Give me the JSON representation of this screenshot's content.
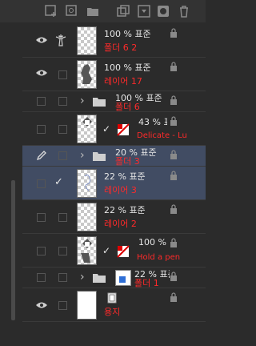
{
  "toolbar": {
    "icons": [
      "new-layer-icon",
      "new-vector-layer-icon",
      "new-folder-icon",
      "copy-layer-icon",
      "merge-layer-icon",
      "mask-icon",
      "delete-icon"
    ]
  },
  "layers": [
    {
      "top": "100 % 표준",
      "name": "폴더 6 2",
      "visible": true,
      "lighthouse": true
    },
    {
      "top": "100 % 표준",
      "name": "레이어 17",
      "visible": true
    },
    {
      "top": "100 % 표준",
      "name": "폴더 6",
      "folder": true
    },
    {
      "top": "43 % 표",
      "name": "Delicate - Lu",
      "effect": true
    },
    {
      "top": "20 % 표준",
      "name": "폴더 3",
      "folder": true,
      "selected": true,
      "pen": true
    },
    {
      "top": "22 % 표준",
      "name": "레이어 3",
      "selected": true,
      "check": true
    },
    {
      "top": "22 % 표준",
      "name": "레이어 2"
    },
    {
      "top": "100 %",
      "name": "Hold a pen",
      "effect": true
    },
    {
      "top": "22 % 표준",
      "name": "폴더 1",
      "folder": true
    },
    {
      "top": "",
      "name": "용지",
      "visible": true,
      "paper": true
    }
  ]
}
